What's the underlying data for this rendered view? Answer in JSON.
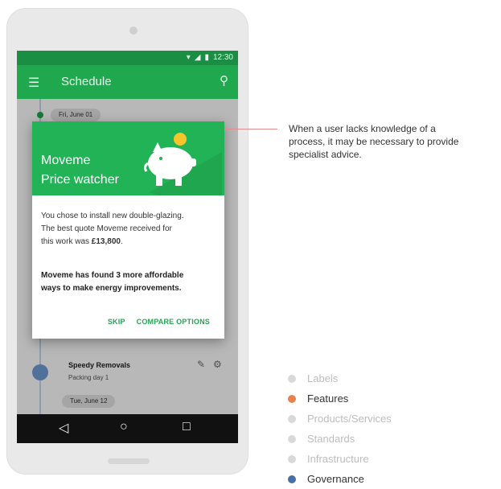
{
  "status_bar": {
    "time": "12:30"
  },
  "app_bar": {
    "title": "Schedule"
  },
  "timeline": {
    "date_top": "Fri, June 01",
    "item": {
      "title": "Speedy Removals",
      "subtitle": "Packing day 1"
    },
    "date_bottom": "Tue, June 12"
  },
  "dialog": {
    "title_line1": "Moveme",
    "title_line2": "Price watcher",
    "body_line1": "You chose to install new double-glazing.",
    "body_line2": "The best quote Moveme received for",
    "body_line3_prefix": "this work was ",
    "body_amount": "£13,800",
    "body_line3_suffix": ".",
    "highlight_line1": "Moveme has found 3 more affordable",
    "highlight_line2": "ways to make energy improvements.",
    "skip_label": "SKIP",
    "compare_label": "COMPARE OPTIONS"
  },
  "annotation": {
    "line1": "When a user lacks knowledge of a",
    "line2": "process, it may be necessary to provide",
    "line3": "specialist advice."
  },
  "legend": [
    {
      "label": "Labels",
      "color": "#d9d9d9",
      "text_color": "#bdbdbd"
    },
    {
      "label": "Features",
      "color": "#e8834f",
      "text_color": "#333333"
    },
    {
      "label": "Products/Services",
      "color": "#d9d9d9",
      "text_color": "#bdbdbd"
    },
    {
      "label": "Standards",
      "color": "#d9d9d9",
      "text_color": "#bdbdbd"
    },
    {
      "label": "Infrastructure",
      "color": "#d9d9d9",
      "text_color": "#bdbdbd"
    },
    {
      "label": "Governance",
      "color": "#4a6fa5",
      "text_color": "#333333"
    }
  ],
  "colors": {
    "brand_green": "#1fa84e",
    "header_green": "#22b356",
    "accent_connector": "#e48b8b"
  }
}
